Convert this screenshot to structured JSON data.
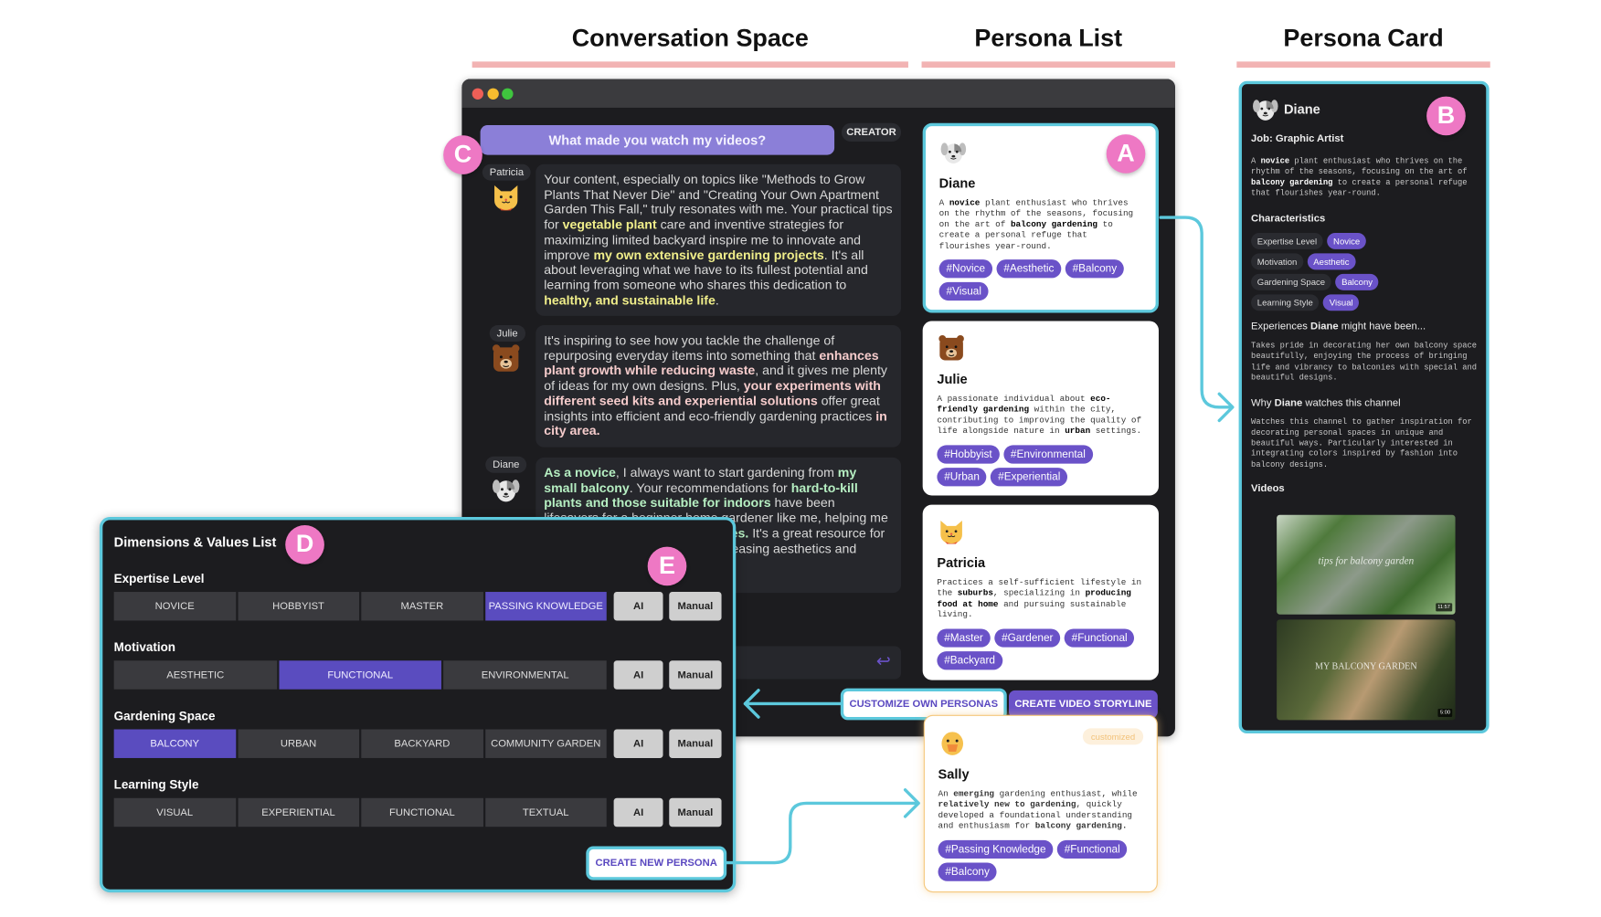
{
  "sections": {
    "conversation": "Conversation Space",
    "persona_list": "Persona List",
    "persona_card": "Persona Card"
  },
  "badges": {
    "a": "A",
    "b": "B",
    "c": "C",
    "d": "D",
    "e": "E"
  },
  "colors": {
    "accent": "#6a52c8",
    "question": "#8b7fd8",
    "cyan": "#5cc8dc",
    "badge": "#ee78c4",
    "hl_patricia": "#f0ee8a",
    "hl_julie": "#f6cccc",
    "hl_diane": "#b6efc2"
  },
  "conversation": {
    "question": "What made you watch my videos?",
    "creator_label": "CREATOR",
    "messages": [
      {
        "name": "Patricia",
        "avatar": "cat-icon",
        "segments": [
          {
            "text": "Your content, especially on topics like \"Methods to Grow Plants That Never Die\" and \"Creating Your Own Apartment Garden This Fall,\" truly resonates with me. Your practical tips for ",
            "bold": false
          },
          {
            "text": "vegetable plant",
            "bold": true
          },
          {
            "text": " care and inventive strategies for maximizing limited backyard inspire me to innovate and improve ",
            "bold": false
          },
          {
            "text": "my own extensive gardening projects",
            "bold": true
          },
          {
            "text": ". It's all about leveraging what we have to its fullest potential and learning from someone who shares this dedication to ",
            "bold": false
          },
          {
            "text": "healthy, and sustainable life",
            "bold": true
          },
          {
            "text": ".",
            "bold": false
          }
        ]
      },
      {
        "name": "Julie",
        "avatar": "bear-icon",
        "segments": [
          {
            "text": "It's inspiring to see how you tackle the challenge of repurposing everyday items into something that ",
            "bold": false
          },
          {
            "text": "enhances plant growth while reducing waste",
            "bold": true
          },
          {
            "text": ", and it gives me plenty of ideas for my own designs. Plus, ",
            "bold": false
          },
          {
            "text": "your experiments with different seed kits and experiential solutions",
            "bold": true
          },
          {
            "text": " offer great insights into efficient and eco-friendly gardening practices ",
            "bold": false
          },
          {
            "text": "in city area.",
            "bold": true
          }
        ]
      },
      {
        "name": "Diane",
        "avatar": "dog-icon",
        "segments": [
          {
            "text": "As a novice",
            "bold": true
          },
          {
            "text": ", I always want to start gardening from ",
            "bold": false
          },
          {
            "text": "my small balcony",
            "bold": true
          },
          {
            "text": ". Your recommendations for ",
            "bold": false
          },
          {
            "text": "hard-to-kill plants and those suitable for indoors",
            "bold": true
          },
          {
            "text": " have been lifesavers for a beginner home gardener like me, helping me avoid common ",
            "bold": false
          },
          {
            "text": "beginner mistakes.",
            "bold": true
          },
          {
            "text": " It's a great resource for making my balcony a space of pleasing aesthetics and",
            "bold": false
          }
        ]
      }
    ]
  },
  "persona_list": [
    {
      "name": "Diane",
      "avatar": "dog-icon",
      "desc": [
        {
          "text": "A ",
          "bold": false
        },
        {
          "text": "novice",
          "bold": true
        },
        {
          "text": " plant enthusiast who thrives on the rhythm of the seasons, focusing on the art of ",
          "bold": false
        },
        {
          "text": "balcony gardening",
          "bold": true
        },
        {
          "text": " to create a personal refuge that flourishes year-round.",
          "bold": false
        }
      ],
      "tags": [
        "#Novice",
        "#Aesthetic",
        "#Balcony",
        "#Visual"
      ]
    },
    {
      "name": "Julie",
      "avatar": "bear-icon",
      "desc": [
        {
          "text": "A passionate individual about ",
          "bold": false
        },
        {
          "text": "eco-friendly gardening",
          "bold": true
        },
        {
          "text": " within the city, contributing to improving the quality of life alongside nature in ",
          "bold": false
        },
        {
          "text": "urban",
          "bold": true
        },
        {
          "text": " settings.",
          "bold": false
        }
      ],
      "tags": [
        "#Hobbyist",
        "#Environmental",
        "#Urban",
        "#Experiential"
      ]
    },
    {
      "name": "Patricia",
      "avatar": "cat-icon",
      "desc": [
        {
          "text": "Practices a self-sufficient lifestyle in the ",
          "bold": false
        },
        {
          "text": "suburbs",
          "bold": true
        },
        {
          "text": ", specializing in ",
          "bold": false
        },
        {
          "text": "producing food at home",
          "bold": true
        },
        {
          "text": " and pursuing sustainable living.",
          "bold": false
        }
      ],
      "tags": [
        "#Master",
        "#Gardener",
        "#Functional",
        "#Backyard"
      ]
    }
  ],
  "buttons": {
    "customize": "CUSTOMIZE OWN PERSONAS",
    "storyline": "CREATE VIDEO STORYLINE",
    "create_new": "CREATE NEW PERSONA"
  },
  "sally": {
    "name": "Sally",
    "badge": "customized",
    "desc": [
      {
        "text": "An ",
        "bold": false
      },
      {
        "text": "emerging",
        "bold": true
      },
      {
        "text": " gardening enthusiast, while ",
        "bold": false
      },
      {
        "text": "relatively new to gardening",
        "bold": true
      },
      {
        "text": ", quickly developed a foundational understanding and enthusiasm for ",
        "bold": false
      },
      {
        "text": "balcony gardening.",
        "bold": true
      }
    ],
    "tags": [
      "#Passing Knowledge",
      "#Functional",
      "#Balcony"
    ]
  },
  "persona_card": {
    "name": "Diane",
    "job": "Job: Graphic Artist",
    "desc": [
      {
        "text": "A ",
        "bold": false
      },
      {
        "text": "novice",
        "bold": true
      },
      {
        "text": " plant enthusiast who thrives on the rhythm of the seasons, focusing on the art of ",
        "bold": false
      },
      {
        "text": "balcony gardening",
        "bold": true
      },
      {
        "text": " to create a personal refuge that flourishes year-round.",
        "bold": false
      }
    ],
    "characteristics_title": "Characteristics",
    "characteristics": [
      {
        "key": "Expertise Level",
        "value": "Novice"
      },
      {
        "key": "Motivation",
        "value": "Aesthetic"
      },
      {
        "key": "Gardening Space",
        "value": "Balcony"
      },
      {
        "key": "Learning Style",
        "value": "Visual"
      }
    ],
    "experiences_heading": [
      {
        "text": "Experiences ",
        "bold": false
      },
      {
        "text": "Diane",
        "bold": true
      },
      {
        "text": " might have been...",
        "bold": false
      }
    ],
    "experiences": "Takes pride in decorating her own balcony space beautifully, enjoying the process of bringing life and vibrancy to balconies with special and beautiful designs.",
    "why_heading": [
      {
        "text": "Why ",
        "bold": false
      },
      {
        "text": "Diane",
        "bold": true
      },
      {
        "text": " watches this channel",
        "bold": false
      }
    ],
    "why": "Watches this channel to gather inspiration for decorating personal spaces in unique and beautiful ways. Particularly interested in integrating colors inspired by fashion into balcony designs.",
    "videos_title": "Videos",
    "videos": [
      {
        "title": "tips for balcony garden",
        "duration": "11:57"
      },
      {
        "title": "MY BALCONY GARDEN",
        "duration": "5:00"
      }
    ]
  },
  "dimensions": {
    "title": "Dimensions & Values List",
    "ai_label": "AI",
    "manual_label": "Manual",
    "rows": [
      {
        "label": "Expertise Level",
        "values": [
          "NOVICE",
          "HOBBYIST",
          "MASTER",
          "PASSING KNOWLEDGE"
        ],
        "selected": 3
      },
      {
        "label": "Motivation",
        "values": [
          "AESTHETIC",
          "FUNCTIONAL",
          "ENVIRONMENTAL"
        ],
        "selected": 1
      },
      {
        "label": "Gardening Space",
        "values": [
          "BALCONY",
          "URBAN",
          "BACKYARD",
          "COMMUNITY GARDEN"
        ],
        "selected": 0
      },
      {
        "label": "Learning Style",
        "values": [
          "VISUAL",
          "EXPERIENTIAL",
          "FUNCTIONAL",
          "TEXTUAL"
        ],
        "selected": -1
      }
    ]
  }
}
